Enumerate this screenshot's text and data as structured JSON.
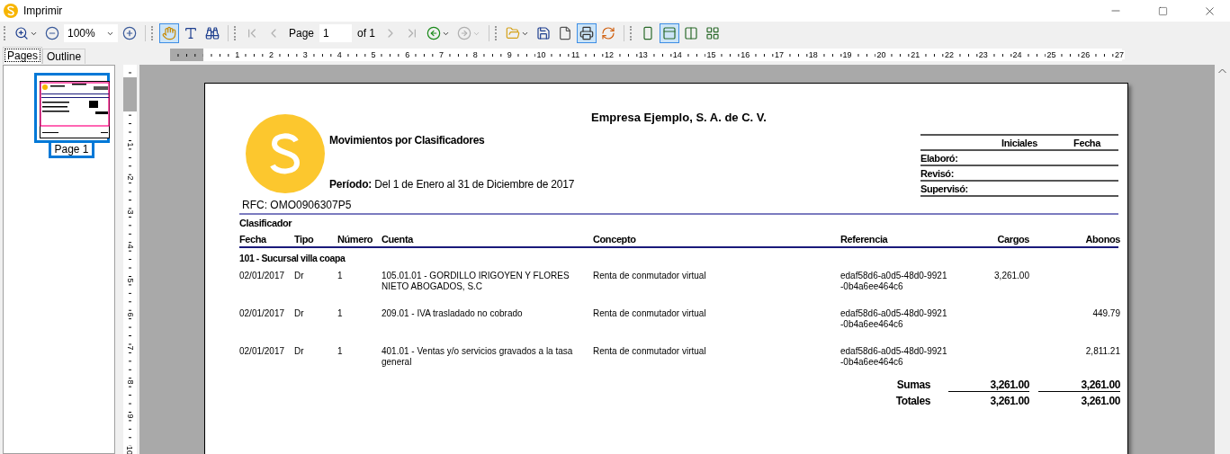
{
  "window": {
    "title": "Imprimir"
  },
  "toolbar": {
    "zoom": "100%",
    "page_label": "Page",
    "page_value": "1",
    "page_of": "of 1",
    "tools": [
      {
        "selected": true
      },
      {
        "selected": false
      },
      {
        "selected": false
      }
    ],
    "nav": [
      {
        "disabled": true
      },
      {
        "disabled": true
      },
      {
        "disabled": true
      },
      {
        "disabled": true
      }
    ],
    "history": [
      {
        "disabled": false
      },
      {
        "disabled": true
      }
    ],
    "file_buttons": [
      {
        "selected": false
      },
      {
        "selected": false
      },
      {
        "selected": false
      },
      {
        "selected": true
      },
      {
        "selected": false
      }
    ],
    "view_modes": [
      {
        "selected": false
      },
      {
        "selected": true
      },
      {
        "selected": false
      },
      {
        "selected": false
      }
    ]
  },
  "side_tabs": [
    {
      "label": "Pages",
      "selected": true
    },
    {
      "label": "Outline",
      "selected": false
    }
  ],
  "thumbnails": [
    {
      "label": "Page 1",
      "selected": true
    }
  ],
  "ruler": {
    "h_labels": [
      "1",
      "2",
      "3",
      "4",
      "5",
      "6",
      "7",
      "8",
      "9",
      "10",
      "11",
      "12",
      "13",
      "14",
      "15",
      "16",
      "17",
      "18",
      "19",
      "20",
      "21",
      "22",
      "23",
      "24",
      "25",
      "26",
      "27"
    ],
    "v_labels": [
      "1",
      "2",
      "3",
      "4",
      "5",
      "6",
      "7",
      "8",
      "9",
      "10"
    ]
  },
  "report": {
    "company": "Empresa Ejemplo, S. A. de C. V.",
    "title": "Movimientos por Clasificadores",
    "period_label": "Período:",
    "period": "Del 1 de Enero al 31 de Diciembre de 2017",
    "rfc": "RFC: OMO0906307P5",
    "signatures": {
      "columns": [
        "Iniciales",
        "Fecha"
      ],
      "rows": [
        "Elaboró:",
        "Revisó:",
        "Supervisó:"
      ]
    },
    "section": "Clasificador",
    "columns": [
      "Fecha",
      "Tipo",
      "Número",
      "Cuenta",
      "Concepto",
      "Referencia",
      "Cargos",
      "Abonos"
    ],
    "group": "101 - Sucursal villa coapa",
    "rows": [
      {
        "fecha": "02/01/2017",
        "tipo": "Dr",
        "numero": "1",
        "cuenta": "105.01.01 - GORDILLO IRIGOYEN Y FLORES NIETO ABOGADOS, S.C",
        "concepto": "Renta de conmutador virtual",
        "referencia": "edaf58d6-a0d5-48d0-9921-0b4a6ee464c6",
        "cargos": "3,261.00",
        "abonos": ""
      },
      {
        "fecha": "02/01/2017",
        "tipo": "Dr",
        "numero": "1",
        "cuenta": "209.01 - IVA trasladado no cobrado",
        "concepto": "Renta de conmutador virtual",
        "referencia": "edaf58d6-a0d5-48d0-9921-0b4a6ee464c6",
        "cargos": "",
        "abonos": "449.79"
      },
      {
        "fecha": "02/01/2017",
        "tipo": "Dr",
        "numero": "1",
        "cuenta": "401.01 - Ventas y/o servicios gravados a la tasa general",
        "concepto": "Renta de conmutador virtual",
        "referencia": "edaf58d6-a0d5-48d0-9921-0b4a6ee464c6",
        "cargos": "",
        "abonos": "2,811.21"
      }
    ],
    "totals": [
      {
        "label": "Sumas",
        "cargos": "3,261.00",
        "abonos": "3,261.00"
      },
      {
        "label": "Totales",
        "cargos": "3,261.00",
        "abonos": "3,261.00"
      }
    ]
  }
}
